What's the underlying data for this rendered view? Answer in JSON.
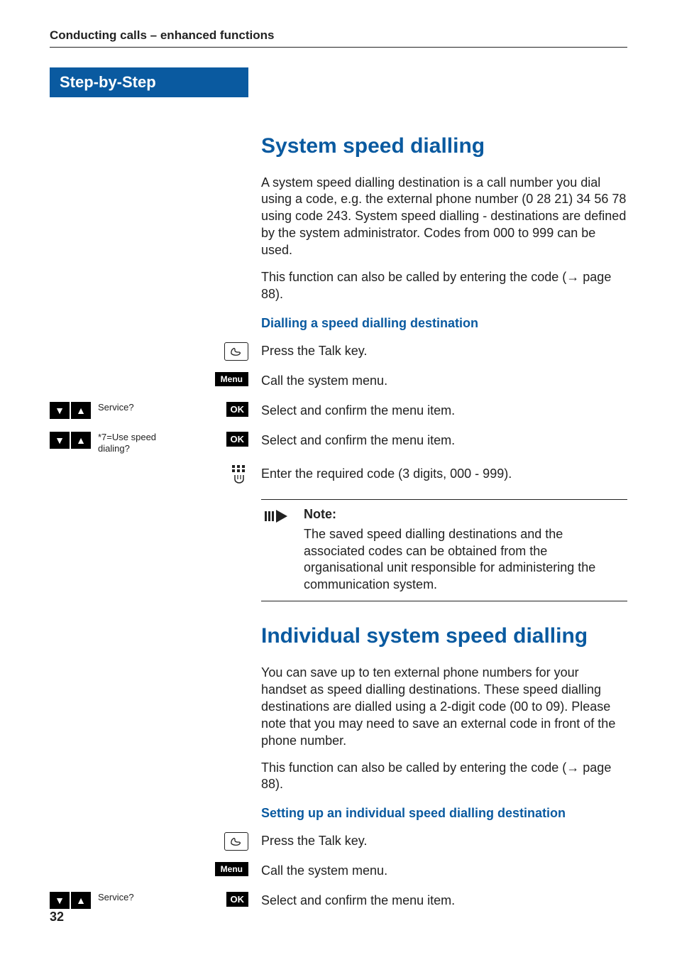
{
  "running_head": "Conducting calls – enhanced functions",
  "step_banner": "Step-by-Step",
  "section1": {
    "title": "System speed dialling",
    "para1": "A system speed dialling destination is a call number you dial using a code, e.g. the external phone number (0 28 21) 34 56 78 using code 243. System speed dialling - destinations are defined by the system administrator. Codes from 000 to 999 can be used.",
    "para2_a": "This function can also be called by entering the code (",
    "para2_link": "page 88",
    "para2_b": ").",
    "sub1": "Dialling a speed dialling destination",
    "steps": [
      {
        "icon": "talk",
        "text": "Press the Talk key."
      },
      {
        "icon": "menu",
        "label": "Menu",
        "text": "Call the system menu."
      },
      {
        "icon": "arrows-ok",
        "display": "Service?",
        "ok": "OK",
        "text": "Select and confirm the menu item."
      },
      {
        "icon": "arrows-ok",
        "display": "*7=Use speed dialing?",
        "ok": "OK",
        "text": "Select and confirm the menu item."
      },
      {
        "icon": "keypad",
        "text": "Enter the required code (3 digits, 000 - 999)."
      }
    ],
    "note": {
      "title": "Note:",
      "body": "The saved speed dialling destinations and the associated codes can be obtained from the organisational unit responsible for administering the communication system."
    }
  },
  "section2": {
    "title": "Individual system speed dialling",
    "para1": "You can save up to ten external phone numbers for your handset as speed dialling destinations. These speed dialling destinations are dialled using a 2-digit code (00 to 09). Please note that you may need to save an external code in front of the phone number.",
    "para2_a": "This function can also be called by entering the code (",
    "para2_link": "page 88",
    "para2_b": ").",
    "sub1": "Setting up an individual speed dialling destination",
    "steps": [
      {
        "icon": "talk",
        "text": "Press the Talk key."
      },
      {
        "icon": "menu",
        "label": "Menu",
        "text": "Call the system menu."
      },
      {
        "icon": "arrows-ok",
        "display": "Service?",
        "ok": "OK",
        "text": "Select and confirm the menu item."
      }
    ]
  },
  "page_number": "32"
}
